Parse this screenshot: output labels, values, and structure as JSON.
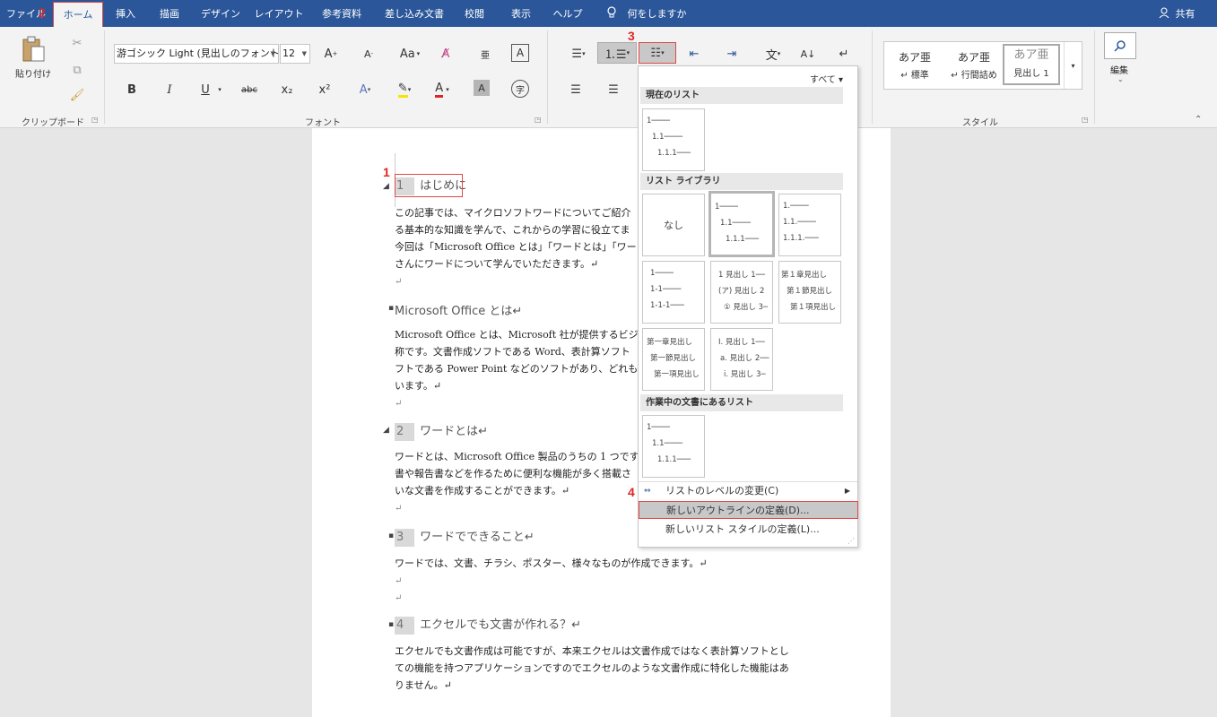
{
  "tabs": {
    "file": "ファイル",
    "home": "ホーム",
    "insert": "挿入",
    "draw": "描画",
    "design": "デザイン",
    "layout": "レイアウト",
    "references": "参考資料",
    "mailings": "差し込み文書",
    "review": "校閲",
    "view": "表示",
    "help": "ヘルプ",
    "tell_me": "何をしますか",
    "share": "共有"
  },
  "ribbon": {
    "clipboard": {
      "paste": "貼り付け",
      "label": "クリップボード"
    },
    "font": {
      "name": "游ゴシック Light (見出しのフォント)",
      "size": "12",
      "label": "フォント",
      "bold": "B",
      "italic": "I",
      "underline": "U",
      "strike": "abc",
      "sub": "x₂",
      "sup": "x²",
      "clear": "A"
    },
    "styles": {
      "label": "スタイル",
      "items": [
        {
          "sample": "あア亜",
          "name": "↵ 標準"
        },
        {
          "sample": "あア亜",
          "name": "↵ 行間詰め"
        },
        {
          "sample": "あア亜",
          "name": "見出し 1"
        }
      ]
    },
    "editing": {
      "label": "編集"
    }
  },
  "gallery": {
    "all": "すべて ▾",
    "current_list": "現在のリスト",
    "library": "リスト ライブラリ",
    "in_document": "作業中の文書にあるリスト",
    "none": "なし",
    "thumbs": {
      "current": [
        "1────",
        "1.1────",
        "1.1.1───"
      ],
      "t2": [
        "1────",
        "1.1────",
        "1.1.1───"
      ],
      "t3": [
        "1.────",
        "1.1.────",
        "1.1.1.───"
      ],
      "t4": [
        "1────",
        "1-1────",
        "1-1-1───"
      ],
      "t5": [
        "1 見出し 1──",
        "(ア) 見出し 2",
        "① 見出し 3─"
      ],
      "t6": [
        "第１章見出し",
        "第１節見出し",
        "第１項見出し"
      ],
      "t7": [
        "第一章見出し",
        "第一節見出し",
        "第一項見出し"
      ],
      "t8": [
        "I. 見出し 1──",
        "a. 見出し 2──",
        "i. 見出し 3─"
      ],
      "doc": [
        "1────",
        "1.1────",
        "1.1.1───"
      ]
    },
    "menu": {
      "change_level": "リストのレベルの変更(C)",
      "define_new": "新しいアウトラインの定義(D)...",
      "define_style": "新しいリスト スタイルの定義(L)..."
    }
  },
  "document": {
    "h1": {
      "num": "1",
      "text": "はじめに"
    },
    "p1": [
      "この記事では、マイクロソフトワードについてご紹介",
      "る基本的な知識を学んで、これからの学習に役立てま",
      "今回は「Microsoft Office とは」「ワードとは」「ワー",
      "さんにワードについて学んでいただきます。↵"
    ],
    "h_office": "Microsoft Office とは↵",
    "p2": [
      "Microsoft Office とは、Microsoft 社が提供するビジ",
      "称です。文書作成ソフトである Word、表計算ソフト",
      "フトである Power Point などのソフトがあり、どれも",
      "います。↵"
    ],
    "h2": {
      "num": "2",
      "text": "ワードとは↵"
    },
    "p3": [
      "ワードとは、Microsoft Office 製品のうちの 1 つです",
      "書や報告書などを作るために便利な機能が多く搭載さ",
      "いな文書を作成することができます。↵"
    ],
    "h3": {
      "num": "3",
      "text": "ワードでできること↵"
    },
    "p4": "ワードでは、文書、チラシ、ポスター、様々なものが作成できます。↵",
    "h4": {
      "num": "4",
      "text": "エクセルでも文書が作れる？↵"
    },
    "p5": [
      "エクセルでも文書作成は可能ですが、本来エクセルは文書作成ではなく表計算ソフトとし",
      "ての機能を持つアプリケーションですのでエクセルのような文書作成に特化した機能はあ",
      "りません。↵"
    ],
    "return_mark": "↵"
  },
  "steps": {
    "s1": "1",
    "s2": "2",
    "s3": "3",
    "s4": "4"
  }
}
